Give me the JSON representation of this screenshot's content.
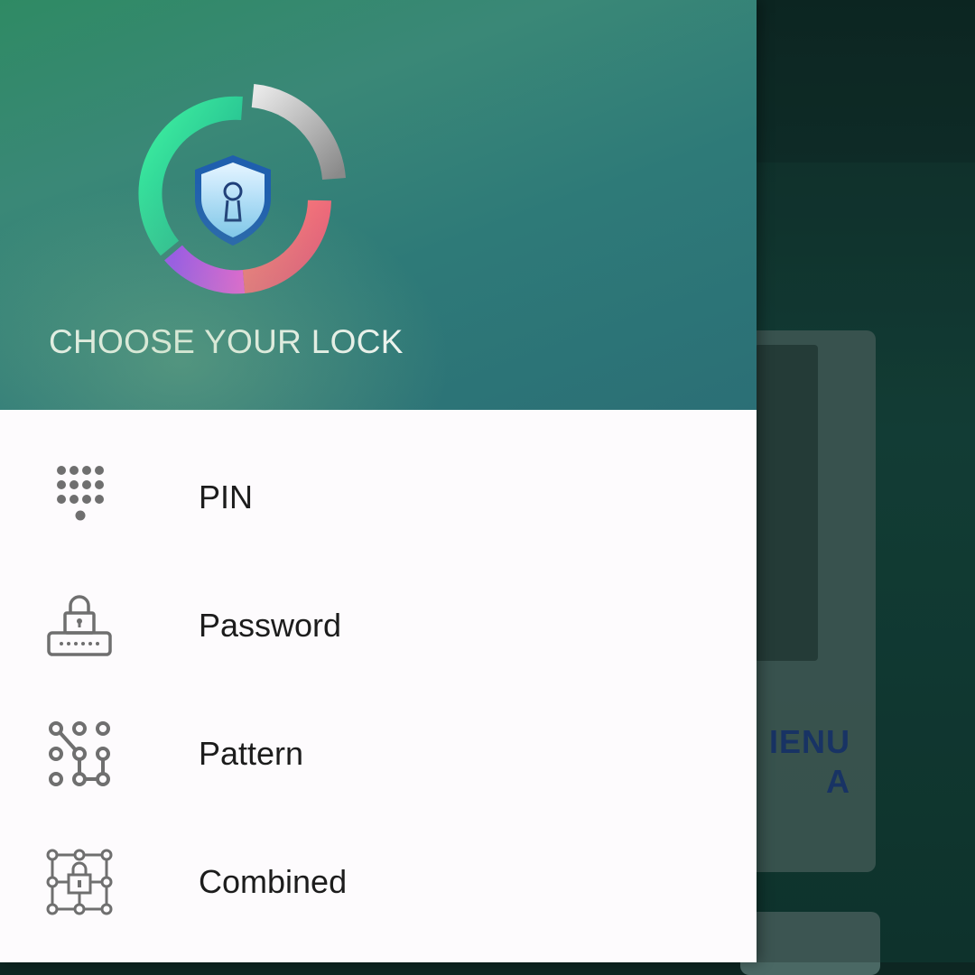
{
  "header": {
    "title": "CHOOSE YOUR LOCK"
  },
  "menu": {
    "items": [
      {
        "label": "PIN",
        "icon": "keypad-icon"
      },
      {
        "label": "Password",
        "icon": "password-lock-icon"
      },
      {
        "label": "Pattern",
        "icon": "pattern-grid-icon"
      },
      {
        "label": "Combined",
        "icon": "combined-lock-icon"
      }
    ]
  },
  "background": {
    "card_text_line1": "IENU",
    "card_text_line2": "A"
  },
  "colors": {
    "header_start": "#2f8a64",
    "header_end": "#2b6f76",
    "drawer_bg": "#fdfbfd",
    "icon_gray": "#6f6f6f"
  }
}
